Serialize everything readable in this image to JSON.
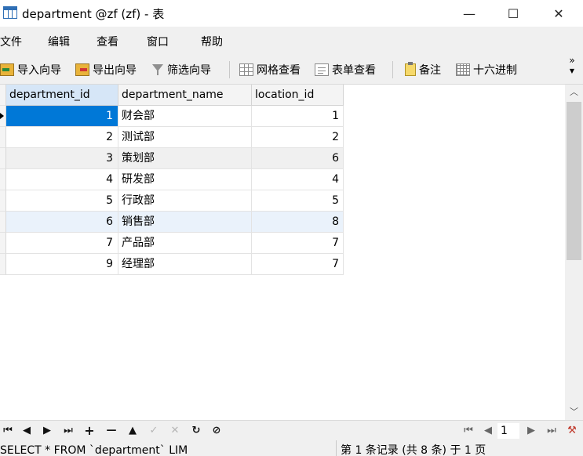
{
  "window": {
    "title": "department @zf (zf) - 表",
    "minimize_glyph": "—",
    "maximize_glyph": "☐",
    "close_glyph": "✕"
  },
  "menu": [
    "文件",
    "编辑",
    "查看",
    "窗口",
    "帮助"
  ],
  "toolbar": {
    "import_wizard": "导入向导",
    "export_wizard": "导出向导",
    "filter_wizard": "筛选向导",
    "grid_view": "网格查看",
    "form_view": "表单查看",
    "memo": "备注",
    "hex": "十六进制",
    "more_glyph": "»"
  },
  "table": {
    "columns": [
      "department_id",
      "department_name",
      "location_id"
    ],
    "rows": [
      {
        "department_id": "1",
        "department_name": "财会部",
        "location_id": "1"
      },
      {
        "department_id": "2",
        "department_name": "测试部",
        "location_id": "2"
      },
      {
        "department_id": "3",
        "department_name": "策划部",
        "location_id": "6"
      },
      {
        "department_id": "4",
        "department_name": "研发部",
        "location_id": "4"
      },
      {
        "department_id": "5",
        "department_name": "行政部",
        "location_id": "5"
      },
      {
        "department_id": "6",
        "department_name": "销售部",
        "location_id": "8"
      },
      {
        "department_id": "7",
        "department_name": "产品部",
        "location_id": "7"
      },
      {
        "department_id": "9",
        "department_name": "经理部",
        "location_id": "7"
      }
    ],
    "selected_row": 0
  },
  "navigator": {
    "first": "⏮",
    "prev": "◀",
    "next": "▶",
    "last": "⏭",
    "add": "+",
    "delete": "—",
    "up": "▲",
    "apply": "✓",
    "cancel": "✕",
    "refresh": "↻",
    "stop": "⊘",
    "page_first": "⏮",
    "page_prev": "◀",
    "page_value": "1",
    "page_next": "▶",
    "page_last": "⏭",
    "settings": "⚒"
  },
  "status": {
    "sql": "SELECT * FROM `department` LIMIT",
    "record_info": "第 1 条记录 (共 8 条) 于 1 页"
  },
  "colors": {
    "selection": "#0078d7",
    "header_highlight": "#d6e6f7",
    "chrome": "#f0f0f0"
  }
}
